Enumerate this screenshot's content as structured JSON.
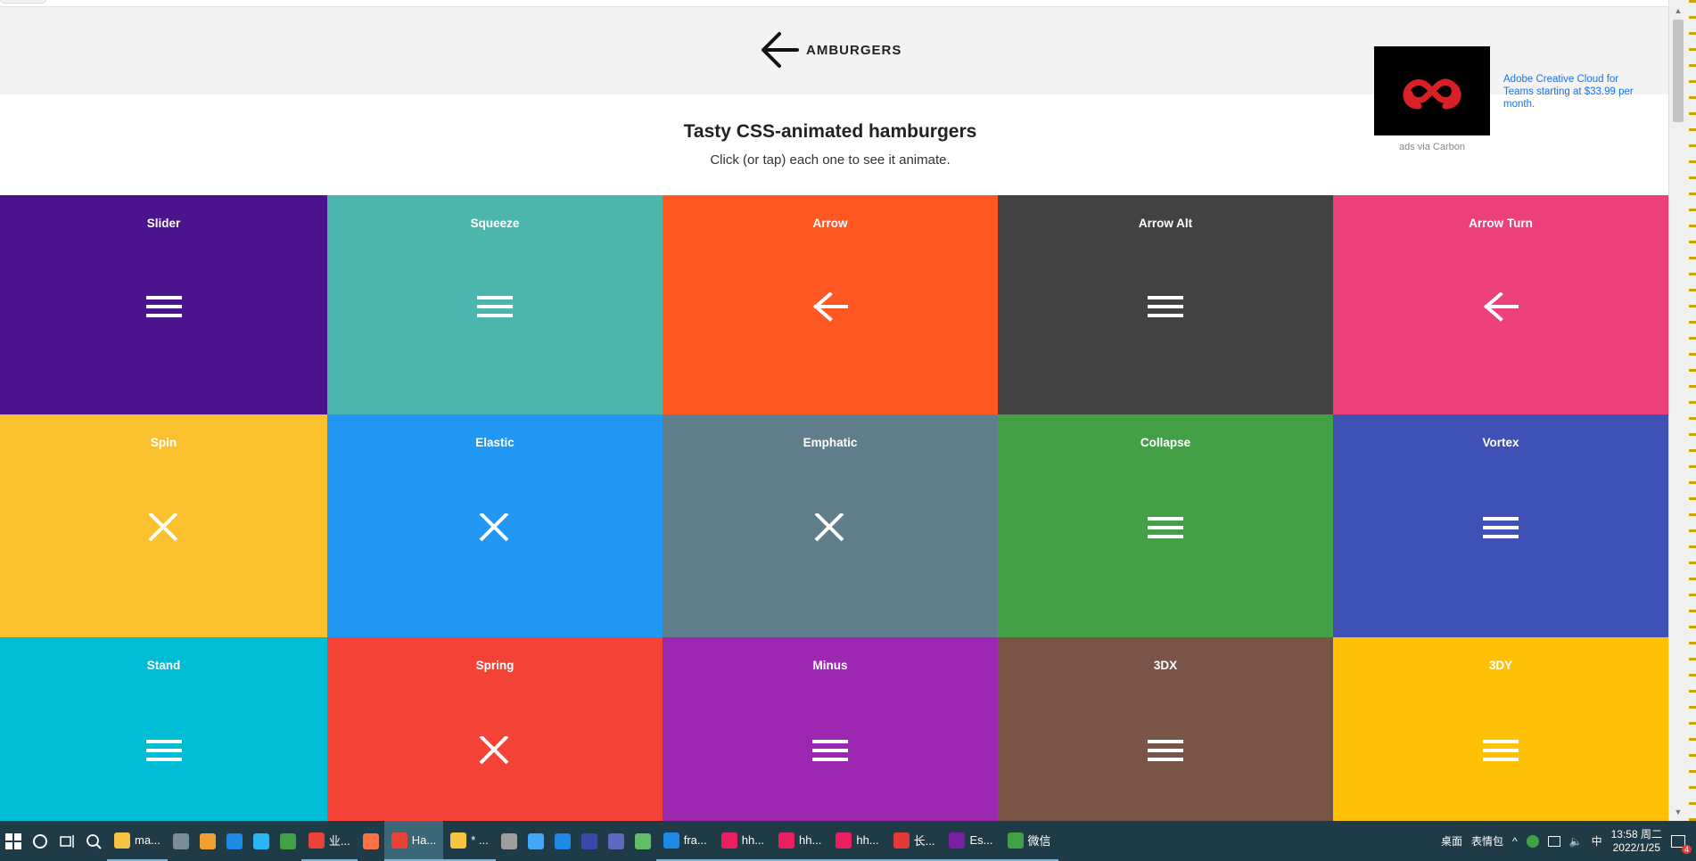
{
  "header": {
    "brand": "AMBURGERS",
    "title": "Tasty CSS-animated hamburgers",
    "subtitle": "Click (or tap) each one to see it animate."
  },
  "ad": {
    "text": "Adobe Creative Cloud for Teams starting at $33.99 per month.",
    "credit": "ads via Carbon"
  },
  "tiles": [
    {
      "label": "Slider",
      "color": "#4a148c",
      "icon": "hamburger"
    },
    {
      "label": "Squeeze",
      "color": "#4db6ac",
      "icon": "hamburger"
    },
    {
      "label": "Arrow",
      "color": "#ff5722",
      "icon": "arrow-left"
    },
    {
      "label": "Arrow Alt",
      "color": "#424242",
      "icon": "hamburger"
    },
    {
      "label": "Arrow Turn",
      "color": "#ec407a",
      "icon": "arrow-left"
    },
    {
      "label": "Spin",
      "color": "#fbc02d",
      "icon": "close"
    },
    {
      "label": "Elastic",
      "color": "#2196f3",
      "icon": "close"
    },
    {
      "label": "Emphatic",
      "color": "#607d8b",
      "icon": "close"
    },
    {
      "label": "Collapse",
      "color": "#43a047",
      "icon": "hamburger"
    },
    {
      "label": "Vortex",
      "color": "#3f51b5",
      "icon": "hamburger"
    },
    {
      "label": "Stand",
      "color": "#00bcd4",
      "icon": "hamburger"
    },
    {
      "label": "Spring",
      "color": "#f44336",
      "icon": "close"
    },
    {
      "label": "Minus",
      "color": "#9c27b0",
      "icon": "hamburger"
    },
    {
      "label": "3DX",
      "color": "#795548",
      "icon": "hamburger"
    },
    {
      "label": "3DY",
      "color": "#ffc107",
      "icon": "hamburger"
    }
  ],
  "taskbar": {
    "apps": [
      {
        "label": "ma...",
        "color": "#f5c542",
        "icon": "folder-icon"
      },
      {
        "label": "",
        "color": "#7b8c99",
        "icon": "photos-icon"
      },
      {
        "label": "",
        "color": "#f0a030",
        "icon": "java-icon"
      },
      {
        "label": "",
        "color": "#1e88e5",
        "icon": "edge-icon"
      },
      {
        "label": "",
        "color": "#29b6f6",
        "icon": "ie-icon"
      },
      {
        "label": "",
        "color": "#43a047",
        "icon": "browser-icon"
      },
      {
        "label": "业...",
        "color": "#ea4335",
        "icon": "chrome-icon"
      },
      {
        "label": "",
        "color": "#ff7043",
        "icon": "firefox-icon"
      },
      {
        "label": "Ha...",
        "color": "#ea4335",
        "icon": "chrome-icon",
        "active": true
      },
      {
        "label": "* ...",
        "color": "#f5c542",
        "icon": "app-icon"
      },
      {
        "label": "",
        "color": "#9e9e9e",
        "icon": "tools-icon"
      },
      {
        "label": "",
        "color": "#42a5f5",
        "icon": "feather-icon"
      },
      {
        "label": "",
        "color": "#1e88e5",
        "icon": "vscode-icon"
      },
      {
        "label": "",
        "color": "#3949ab",
        "icon": "eclipse-icon"
      },
      {
        "label": "",
        "color": "#5c6bc0",
        "icon": "eclipse-icon"
      },
      {
        "label": "",
        "color": "#66bb6a",
        "icon": "app-icon"
      },
      {
        "label": "fra...",
        "color": "#1e88e5",
        "icon": "webstorm-icon"
      },
      {
        "label": "hh...",
        "color": "#e91e63",
        "icon": "idea-icon"
      },
      {
        "label": "hh...",
        "color": "#e91e63",
        "icon": "idea-icon"
      },
      {
        "label": "hh...",
        "color": "#e91e63",
        "icon": "idea-icon"
      },
      {
        "label": "长...",
        "color": "#e53935",
        "icon": "wps-icon"
      },
      {
        "label": "Es...",
        "color": "#7b1fa2",
        "icon": "onenote-icon"
      },
      {
        "label": "微信",
        "color": "#43a047",
        "icon": "wechat-icon"
      }
    ],
    "desktop": "桌面",
    "emoji": "表情包",
    "ime": "中",
    "time": "13:58 周二",
    "date": "2022/1/25",
    "notify_count": "4"
  }
}
